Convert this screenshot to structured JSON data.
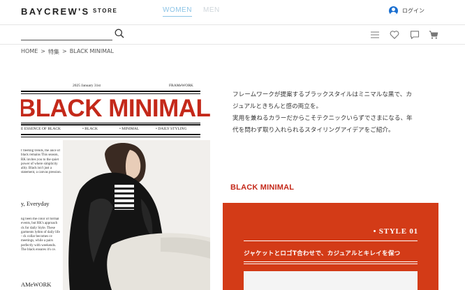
{
  "header": {
    "logo": "BAYCREW'S",
    "logo_sub": "STORE",
    "tabs": [
      {
        "label": "WOMEN",
        "active": true
      },
      {
        "label": "MEN",
        "active": false
      }
    ],
    "login_label": "ログイン"
  },
  "search": {
    "placeholder": "",
    "value": ""
  },
  "breadcrumb": [
    "HOME",
    ">",
    "特集",
    ">",
    "BLACK MINIMAL"
  ],
  "feature_visual": {
    "date": "2025 January 31st",
    "brand": "FRAMeWORK",
    "title": "BLACK MINIMAL",
    "strap": [
      "E ESSENCE OF BLACK",
      "• BLACK",
      "• MINIMAL",
      "• DAILY STYLING"
    ],
    "column_text_1": "f fleeting trends, the ance of black remains This season, RK invites you to the quiet power of where simplicity ality. Black isn't just a statement, a canvas pression.",
    "subhead": "y, Everyday",
    "column_text_2": "ng been the color of formal events, but RK's approach ck for daily Style. These garments lythm of daily life - ck collar becomes ce meetings, while a pairs perfectly with weekends. The black ensures it's ce.",
    "footer": "AMeWORK"
  },
  "intro": [
    "フレームワークが提案するブラックスタイルはミニマルな黒で、カ",
    "ジュアルときちんと感の両立を。",
    "実用を兼ねるカラーだからこそテクニックいらずでさまになる、年",
    "代を問わず取り入れられるスタイリングアイデアをご紹介。"
  ],
  "section_heading": "BLACK MINIMAL",
  "style_card": {
    "label": "• STYLE 01",
    "caption": "ジャケットとロゴT合わせで、カジュアルとキレイを保つ"
  },
  "colors": {
    "accent_red": "#c4291a",
    "card_red": "#d33b17",
    "women_tab": "#8cc4e6",
    "login_icon": "#1a6fd0"
  },
  "icons": [
    "person-circle-icon",
    "search-icon",
    "menu-icon",
    "heart-icon",
    "chat-icon",
    "cart-icon"
  ]
}
